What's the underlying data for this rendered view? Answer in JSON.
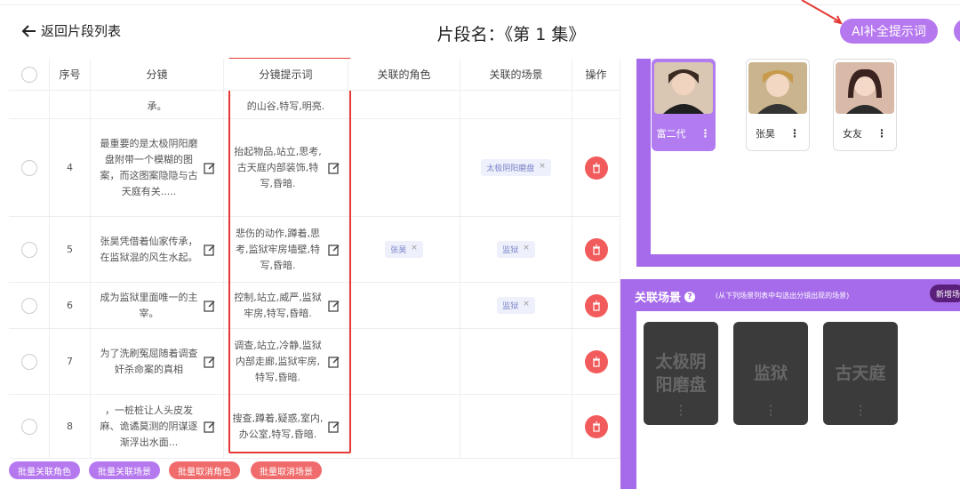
{
  "header": {
    "back_label": "返回片段列表",
    "title": "片段名：《第 1 集》",
    "ai_button": "AI补全提示词"
  },
  "table": {
    "columns": [
      "",
      "序号",
      "分镜",
      "分镜提示词",
      "关联的角色",
      "关联的场景",
      "操作"
    ],
    "partial_row": {
      "shot": "承。",
      "prompt": "的山谷,特写,明亮."
    },
    "rows": [
      {
        "index": "4",
        "shot": "最重要的是太极阴阳磨盘附带一个模糊的图案，而这图案隐隐与古天庭有关.....",
        "prompt": "抬起物品,站立,思考,古天庭内部装饰,特写,昏暗.",
        "role_tag": "",
        "scene_tag": "太极阴阳磨盘"
      },
      {
        "index": "5",
        "shot": "张昊凭借着仙家传承，在监狱混的风生水起。",
        "prompt": "悲伤的动作,蹲着,思考,监狱牢房墙壁,特写,昏暗.",
        "role_tag": "张昊",
        "scene_tag": "监狱"
      },
      {
        "index": "6",
        "shot": "成为监狱里面唯一的主宰。",
        "prompt": "控制,站立,威严,监狱牢房,特写,昏暗.",
        "role_tag": "",
        "scene_tag": "监狱"
      },
      {
        "index": "7",
        "shot": "为了洗刷冤屈随着调查奸杀命案的真相",
        "prompt": "调查,站立,冷静,监狱内部走廊,监狱牢房,特写,昏暗.",
        "role_tag": "",
        "scene_tag": ""
      },
      {
        "index": "8",
        "shot": "，一桩桩让人头皮发麻、诡谲莫测的阴谋逐渐浮出水面...",
        "prompt": "搜查,蹲着,疑惑,室内,办公室,特写,昏暗.",
        "role_tag": "",
        "scene_tag": ""
      }
    ],
    "tag_close": "×"
  },
  "batch": {
    "link_role": "批量关联角色",
    "link_scene": "批量关联场景",
    "cancel_role": "批量取消角色",
    "cancel_scene": "批量取消场景"
  },
  "characters": [
    {
      "name": "富二代",
      "selected": true
    },
    {
      "name": "张昊",
      "selected": false
    },
    {
      "name": "女友",
      "selected": false
    }
  ],
  "scenes_panel": {
    "title": "关联场景",
    "hint": "(从下列场景列表中勾选出分镜出现的场景)",
    "new_button": "新增场",
    "scenes": [
      "太极阴阳磨盘",
      "监狱",
      "古天庭"
    ]
  },
  "colors": {
    "accent": "#a66bea",
    "delete": "#f25b5b",
    "highlight": "#e53935"
  }
}
